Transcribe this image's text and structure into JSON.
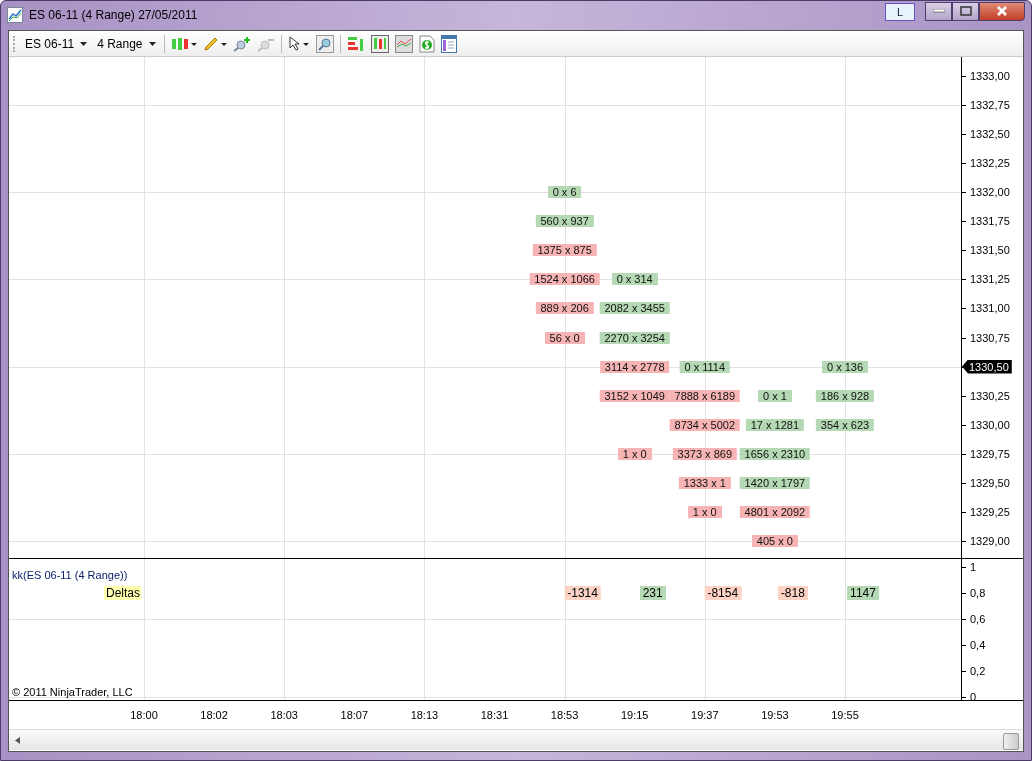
{
  "window": {
    "title": "ES 06-11 (4 Range)  27/05/2011",
    "layout_button": "L"
  },
  "toolbar": {
    "instrument": "ES 06-11",
    "period": "4 Range"
  },
  "price_axis": [
    {
      "label": "1333,00",
      "current": false
    },
    {
      "label": "1332,75",
      "current": false
    },
    {
      "label": "1332,50",
      "current": false
    },
    {
      "label": "1332,25",
      "current": false
    },
    {
      "label": "1332,00",
      "current": false
    },
    {
      "label": "1331,75",
      "current": false
    },
    {
      "label": "1331,50",
      "current": false
    },
    {
      "label": "1331,25",
      "current": false
    },
    {
      "label": "1331,00",
      "current": false
    },
    {
      "label": "1330,75",
      "current": false
    },
    {
      "label": "1330,50",
      "current": true
    },
    {
      "label": "1330,25",
      "current": false
    },
    {
      "label": "1330,00",
      "current": false
    },
    {
      "label": "1329,75",
      "current": false
    },
    {
      "label": "1329,50",
      "current": false
    },
    {
      "label": "1329,25",
      "current": false
    },
    {
      "label": "1329,00",
      "current": false
    }
  ],
  "time_columns": [
    {
      "time": "18:00"
    },
    {
      "time": "18:02"
    },
    {
      "time": "18:03"
    },
    {
      "time": "18:07"
    },
    {
      "time": "18:13"
    },
    {
      "time": "18:31"
    },
    {
      "time": "18:53",
      "delta": {
        "text": "-1314",
        "color": "#fcd3c4"
      },
      "cells": [
        null,
        null,
        null,
        null,
        {
          "text": "0 x 6",
          "color": "#b4d9b4"
        },
        {
          "text": "560 x 937",
          "color": "#b4d9b4"
        },
        {
          "text": "1375 x 875",
          "color": "#f7b4b4"
        },
        {
          "text": "1524 x 1066",
          "color": "#f7b4b4"
        },
        {
          "text": "889 x 206",
          "color": "#f7b4b4"
        },
        {
          "text": "56 x 0",
          "color": "#f7b4b4"
        }
      ]
    },
    {
      "time": "19:15",
      "delta": {
        "text": "231",
        "color": "#b4d9b4"
      },
      "cells": [
        null,
        null,
        null,
        null,
        null,
        null,
        null,
        {
          "text": "0 x 314",
          "color": "#b4d9b4"
        },
        {
          "text": "2082 x 3455",
          "color": "#b4d9b4"
        },
        {
          "text": "2270 x 3254",
          "color": "#b4d9b4"
        },
        {
          "text": "3114 x 2778",
          "color": "#f7b4b4"
        },
        {
          "text": "3152 x 1049",
          "color": "#f7b4b4"
        },
        null,
        {
          "text": "1 x 0",
          "color": "#f7b4b4"
        }
      ]
    },
    {
      "time": "19:37",
      "delta": {
        "text": "-8154",
        "color": "#fcd3c4"
      },
      "cells": [
        null,
        null,
        null,
        null,
        null,
        null,
        null,
        null,
        null,
        null,
        {
          "text": "0 x 1114",
          "color": "#b4d9b4"
        },
        {
          "text": "7888 x 6189",
          "color": "#f7b4b4"
        },
        {
          "text": "8734 x 5002",
          "color": "#f7b4b4"
        },
        {
          "text": "3373 x 869",
          "color": "#f7b4b4"
        },
        {
          "text": "1333 x 1",
          "color": "#f7b4b4"
        },
        {
          "text": "1 x 0",
          "color": "#f7b4b4"
        }
      ]
    },
    {
      "time": "19:53",
      "delta": {
        "text": "-818",
        "color": "#fcd3c4"
      },
      "cells": [
        null,
        null,
        null,
        null,
        null,
        null,
        null,
        null,
        null,
        null,
        null,
        {
          "text": "0 x 1",
          "color": "#b4d9b4"
        },
        {
          "text": "17 x 1281",
          "color": "#b4d9b4"
        },
        {
          "text": "1656 x 2310",
          "color": "#b4d9b4"
        },
        {
          "text": "1420 x 1797",
          "color": "#b4d9b4"
        },
        {
          "text": "4801 x 2092",
          "color": "#f7b4b4"
        },
        {
          "text": "405 x 0",
          "color": "#f7b4b4"
        }
      ]
    },
    {
      "time": "19:55",
      "delta": {
        "text": "1147",
        "color": "#b4d9b4"
      },
      "cells": [
        null,
        null,
        null,
        null,
        null,
        null,
        null,
        null,
        null,
        null,
        {
          "text": "0 x 136",
          "color": "#b4d9b4"
        },
        {
          "text": "186 x 928",
          "color": "#b4d9b4"
        },
        {
          "text": "354 x 623",
          "color": "#b4d9b4"
        }
      ]
    }
  ],
  "indicator_panel": {
    "title": "kk(ES 06-11 (4 Range))",
    "label": "Deltas",
    "axis": [
      "1",
      "0,8",
      "0,6",
      "0,4",
      "0,2",
      "0"
    ]
  },
  "copyright": "© 2011 NinjaTrader, LLC"
}
